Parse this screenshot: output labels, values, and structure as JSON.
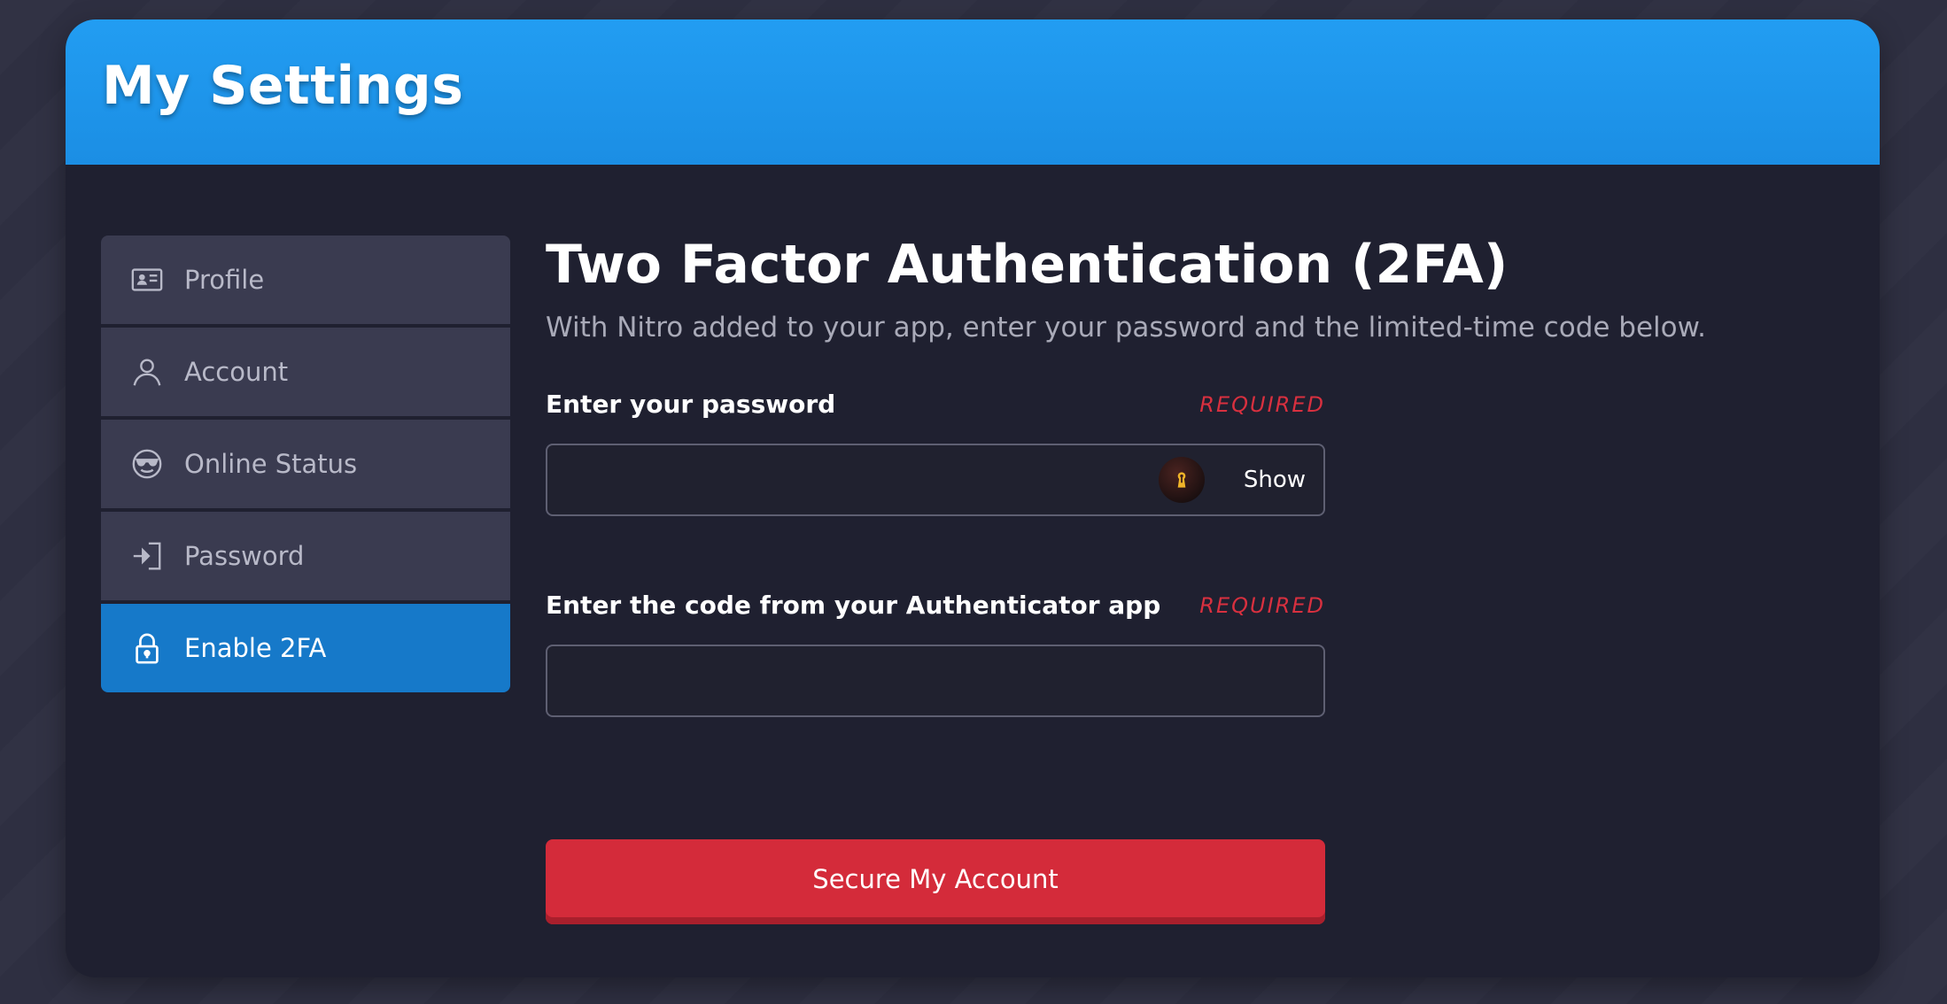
{
  "header": {
    "title": "My Settings"
  },
  "sidebar": {
    "items": [
      {
        "label": "Profile",
        "icon": "id-card-icon",
        "active": false
      },
      {
        "label": "Account",
        "icon": "user-icon",
        "active": false
      },
      {
        "label": "Online Status",
        "icon": "sunglasses-face-icon",
        "active": false
      },
      {
        "label": "Password",
        "icon": "sign-in-icon",
        "active": false
      },
      {
        "label": "Enable 2FA",
        "icon": "lock-icon",
        "active": true
      }
    ]
  },
  "main": {
    "title": "Two Factor Authentication (2FA)",
    "subtitle": "With Nitro added to your app, enter your password and the limited-time code below.",
    "password_field": {
      "label": "Enter your password",
      "required": "REQUIRED",
      "value": "",
      "show_label": "Show"
    },
    "code_field": {
      "label": "Enter the code from your Authenticator app",
      "required": "REQUIRED",
      "value": ""
    },
    "submit_label": "Secure My Account"
  },
  "colors": {
    "header": "#229df2",
    "active_item": "#1679c9",
    "required": "#d8303f",
    "submit": "#d42b3a"
  }
}
